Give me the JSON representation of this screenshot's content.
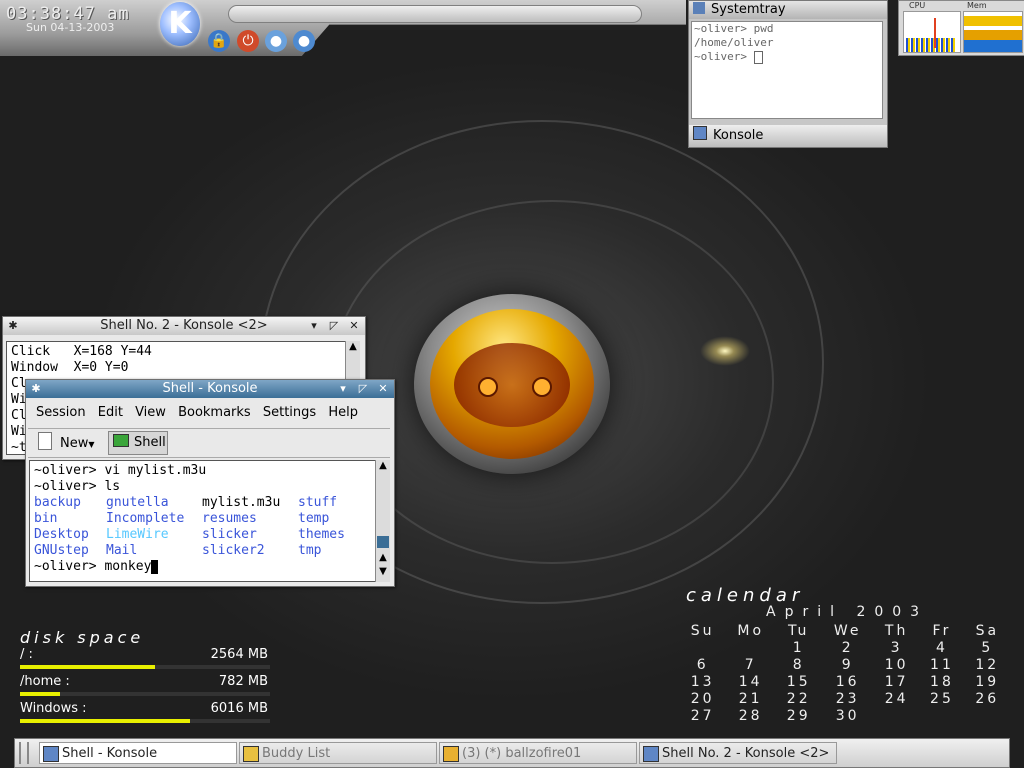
{
  "clock": {
    "time": "03:38:47 am",
    "date": "Sun 04-13-2003"
  },
  "kmenu": {
    "label": "K"
  },
  "systemtray": {
    "title": "Systemtray",
    "terminal_lines": [
      "~oliver> pwd",
      "/home/oliver",
      "~oliver> "
    ],
    "footer_label": "Konsole"
  },
  "monitor": {
    "cpu_label": "CPU",
    "mem_label": "Mem"
  },
  "back_window": {
    "title": "Shell No. 2 - Konsole <2>",
    "lines": [
      "Click   X=168 Y=44",
      "Window  X=0 Y=0",
      "Cl",
      "Wi",
      "Cl",
      "Wi",
      "~t"
    ]
  },
  "front_window": {
    "title": "Shell - Konsole",
    "menu": [
      "Session",
      "Edit",
      "View",
      "Bookmarks",
      "Settings",
      "Help"
    ],
    "toolbar": {
      "new_label": "New",
      "tab_label": "Shell"
    },
    "lines": {
      "l1": "~oliver> vi mylist.m3u",
      "l2": "~oliver> ls",
      "prompt": "~oliver> monkey"
    },
    "ls_columns": [
      [
        "backup",
        "bin",
        "Desktop",
        "GNUstep"
      ],
      [
        "gnutella",
        "Incomplete",
        "LimeWire",
        "Mail"
      ],
      [
        "mylist.m3u",
        "resumes",
        "slicker",
        "slicker2"
      ],
      [
        "stuff",
        "temp",
        "themes",
        "tmp"
      ]
    ]
  },
  "disk": {
    "title": "disk space",
    "rows": [
      {
        "label": "/ :",
        "value": "2564 MB",
        "fill": 0.54
      },
      {
        "label": "/home :",
        "value": "782 MB",
        "fill": 0.16
      },
      {
        "label": "Windows :",
        "value": "6016 MB",
        "fill": 0.68
      }
    ]
  },
  "calendar": {
    "title": "calendar",
    "month": "April 2003",
    "weekdays": [
      "Su",
      "Mo",
      "Tu",
      "We",
      "Th",
      "Fr",
      "Sa"
    ],
    "weeks": [
      [
        "",
        "",
        "1",
        "2",
        "3",
        "4",
        "5"
      ],
      [
        "6",
        "7",
        "8",
        "9",
        "10",
        "11",
        "12"
      ],
      [
        "13",
        "14",
        "15",
        "16",
        "17",
        "18",
        "19"
      ],
      [
        "20",
        "21",
        "22",
        "23",
        "24",
        "25",
        "26"
      ],
      [
        "27",
        "28",
        "29",
        "30",
        "",
        "",
        ""
      ]
    ]
  },
  "taskbar": {
    "tasks": [
      {
        "label": "Shell - Konsole"
      },
      {
        "label": "Buddy List"
      },
      {
        "label": "(3) (*) ballzofire01"
      },
      {
        "label": "Shell No. 2 - Konsole <2>"
      }
    ]
  }
}
